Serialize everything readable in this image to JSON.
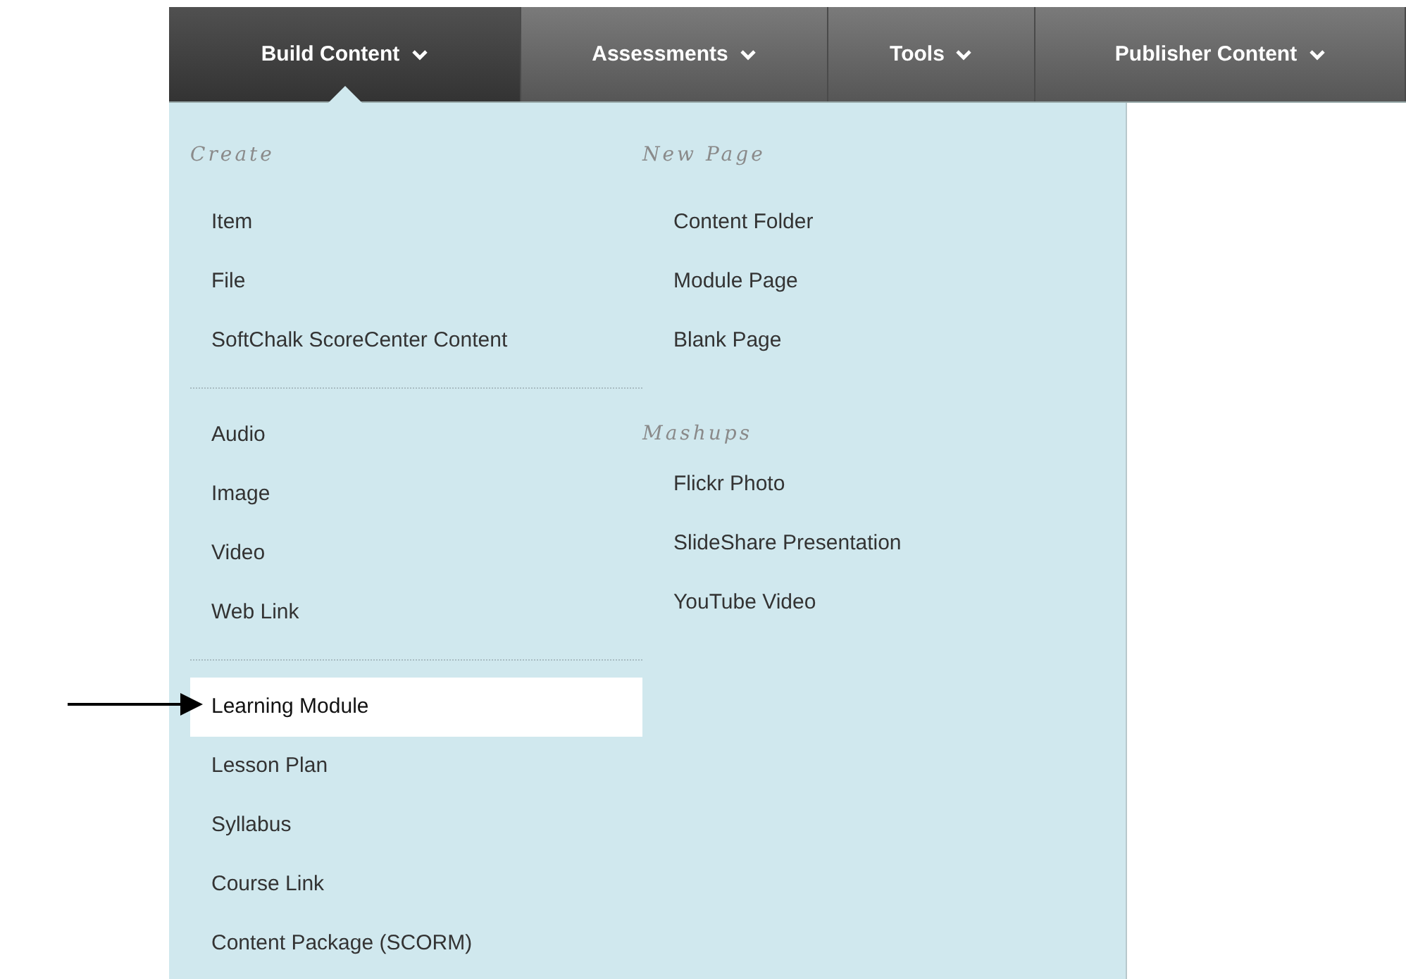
{
  "nav": {
    "tabs": [
      {
        "label": "Build Content",
        "selected": true
      },
      {
        "label": "Assessments",
        "selected": false
      },
      {
        "label": "Tools",
        "selected": false
      },
      {
        "label": "Publisher Content",
        "selected": false
      }
    ]
  },
  "menu": {
    "left_column": [
      {
        "heading": "Create",
        "items": [
          {
            "label": "Item",
            "selected": false
          },
          {
            "label": "File",
            "selected": false
          },
          {
            "label": "SoftChalk ScoreCenter Content",
            "selected": false
          }
        ]
      },
      {
        "items": [
          {
            "label": "Audio",
            "selected": false
          },
          {
            "label": "Image",
            "selected": false
          },
          {
            "label": "Video",
            "selected": false
          },
          {
            "label": "Web Link",
            "selected": false
          }
        ]
      },
      {
        "items": [
          {
            "label": "Learning Module",
            "selected": true
          },
          {
            "label": "Lesson Plan",
            "selected": false
          },
          {
            "label": "Syllabus",
            "selected": false
          },
          {
            "label": "Course Link",
            "selected": false
          },
          {
            "label": "Content Package (SCORM)",
            "selected": false
          }
        ]
      }
    ],
    "right_column": [
      {
        "heading": "New Page",
        "items": [
          {
            "label": "Content Folder",
            "selected": false
          },
          {
            "label": "Module Page",
            "selected": false
          },
          {
            "label": "Blank Page",
            "selected": false
          }
        ]
      },
      {
        "heading": "Mashups",
        "items": [
          {
            "label": "Flickr Photo",
            "selected": false
          },
          {
            "label": "SlideShare Presentation",
            "selected": false
          },
          {
            "label": "YouTube Video",
            "selected": false
          }
        ]
      }
    ]
  },
  "annotation": {
    "kind": "arrow"
  }
}
